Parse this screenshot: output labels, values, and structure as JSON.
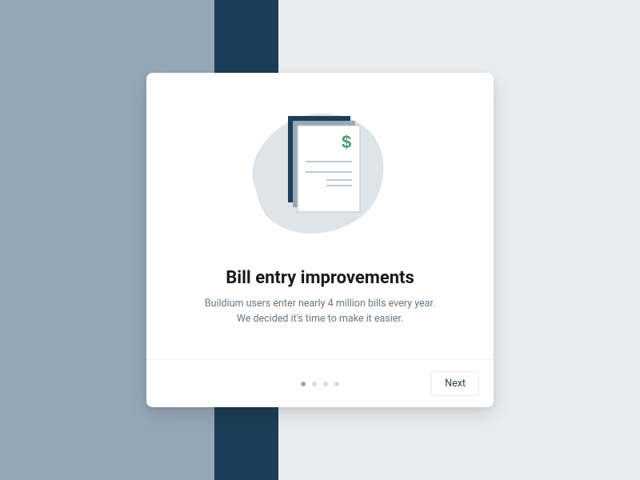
{
  "modal": {
    "title": "Bill entry improvements",
    "subtitle_line1": "Buildium users enter nearly 4 million bills every year.",
    "subtitle_line2": "We decided it's time to make it easier.",
    "next_label": "Next",
    "pagination": {
      "total": 4,
      "current": 1
    },
    "illustration": {
      "icon": "bill-document-icon",
      "accent_color": "#4e9b6f",
      "blob_color": "#dee4e8",
      "back_doc_color": "#1d3e58",
      "mid_doc_color": "#98a8b6",
      "front_doc_color": "#ffffff",
      "line_color": "#c0c9d0"
    }
  }
}
